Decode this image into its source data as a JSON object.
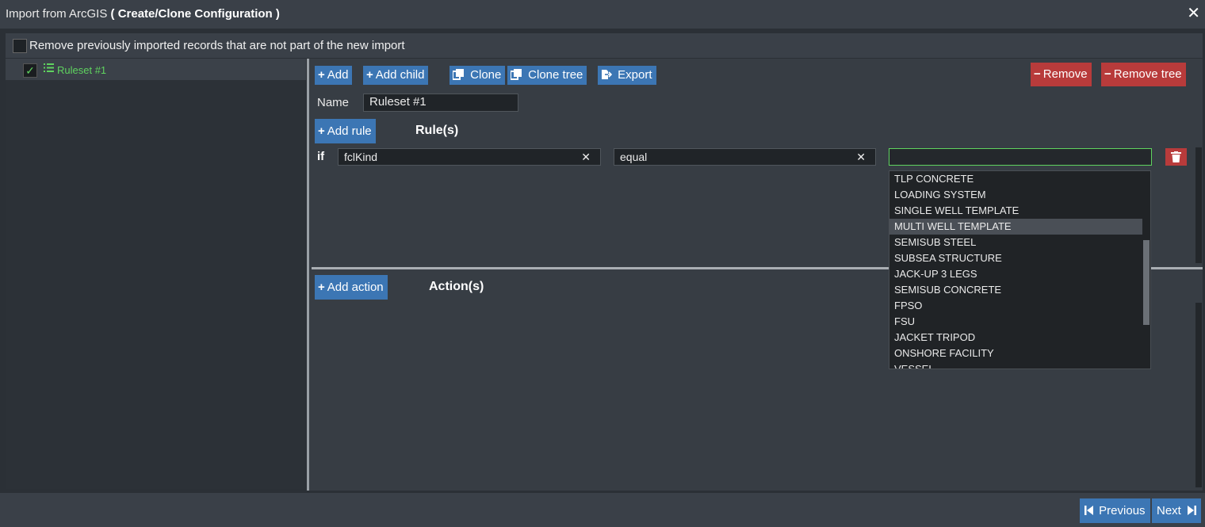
{
  "window": {
    "title_prefix": "Import from ArcGIS",
    "title_bold": "( Create/Clone Configuration )",
    "close_glyph": "✕"
  },
  "options": {
    "remove_previous_label": "Remove previously imported records that are not part of the new import",
    "remove_previous_checked": false
  },
  "tree": {
    "items": [
      {
        "label": "Ruleset #1",
        "checked": true,
        "check_glyph": "✓",
        "icon": "list-icon"
      }
    ]
  },
  "toolbar": {
    "add": "Add",
    "add_child": "Add child",
    "clone": "Clone",
    "clone_tree": "Clone tree",
    "export": "Export",
    "remove": "Remove",
    "remove_tree": "Remove tree"
  },
  "form": {
    "name_label": "Name",
    "name_value": "Ruleset #1"
  },
  "rules": {
    "add_rule_label": "Add rule",
    "heading": "Rule(s)",
    "if_label": "if",
    "rule": {
      "field": "fclKind",
      "operator": "equal",
      "value": ""
    }
  },
  "dropdown": {
    "options": [
      "TLP CONCRETE",
      "LOADING SYSTEM",
      "SINGLE WELL TEMPLATE",
      "MULTI WELL TEMPLATE",
      "SEMISUB STEEL",
      "SUBSEA STRUCTURE",
      "JACK-UP 3 LEGS",
      "SEMISUB CONCRETE",
      "FPSO",
      "FSU",
      "JACKET TRIPOD",
      "ONSHORE FACILITY",
      "VESSEL"
    ],
    "highlighted": "MULTI WELL TEMPLATE"
  },
  "actions": {
    "add_action_label": "Add action",
    "heading": "Action(s)"
  },
  "footer": {
    "previous": "Previous",
    "next": "Next"
  },
  "colors": {
    "primary_button": "#3c76b4",
    "danger_button": "#b83b3b",
    "tree_accent": "#5fd35f"
  }
}
